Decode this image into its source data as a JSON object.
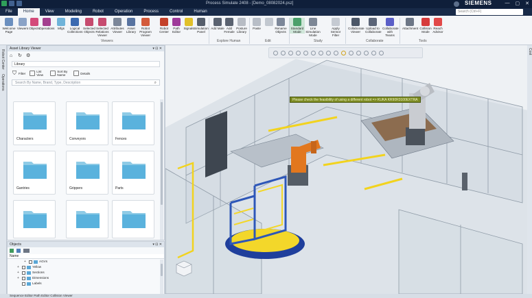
{
  "window": {
    "title": "Process Simulate 2408 - [Demo_08082024.psz]",
    "brand": "SIEMENS",
    "controls": [
      "—",
      "▢",
      "✕"
    ]
  },
  "menu": {
    "items": [
      "File",
      "Home",
      "View",
      "Modeling",
      "Robot",
      "Operation",
      "Process",
      "Control",
      "Human"
    ],
    "active": "Home",
    "search_placeholder": "Search (Ctrl+F)"
  },
  "ribbon": {
    "groups": [
      "Viewers",
      "Explore Human",
      "Edit",
      "Study",
      "Collaborate",
      "Tools"
    ],
    "buttons": {
      "welcome": "Welcome Page",
      "viewers": "Viewers",
      "objects": "Objects",
      "operations": "Operations",
      "mfgs": "Mfgs",
      "logical_collections": "Logical Collections",
      "selected_objects": "Selected Objects",
      "selected_relations": "Selected Relations Viewer",
      "attributes": "Attributes Viewer",
      "asset_library": "Asset Library",
      "robot_program": "Robot Program Viewer",
      "robot_center": "Robot Center",
      "path_editor": "Path Editor",
      "signals": "Signals",
      "simulation_panel": "Simulation Panel",
      "add_male": "Add Male",
      "add_female": "Add Female",
      "posture_library": "Posture Library",
      "paste": "Paste",
      "copy": "",
      "rename_objects": "Rename Objects",
      "standard_mode": "Standard Mode",
      "line_simulation": "Line Simulation Mode",
      "apply_filter": "Apply Sensor Filter",
      "collaborate_viewer": "Collaborate Viewer",
      "upload": "Upload to Collaborate",
      "collab_teams": "Collaborate with Teams",
      "attachment": "Attachment",
      "collision_mode": "Collision Mode",
      "reach_advisor": "Reach Advisor"
    }
  },
  "left_tabs": [
    "Robot Center",
    "Operations"
  ],
  "right_tabs": [
    "Cost"
  ],
  "asset_library": {
    "title": "Asset Library Viewer",
    "path_label": "Library",
    "filter_label": "Filter",
    "list_view_label": "List View",
    "sort_label": "Sort By Name",
    "details_label": "Details",
    "search_placeholder": "Search By Name, Brand, Type, Description",
    "folders": [
      "Characters",
      "Conveyors",
      "Fences",
      "Gantries",
      "Grippers",
      "Parts",
      "",
      "",
      ""
    ]
  },
  "objects_panel": {
    "title": "Objects",
    "column": "Name",
    "rows": [
      "AGVs",
      "Yellow",
      "Sections",
      "Dimensions",
      "Labels",
      "Frames"
    ]
  },
  "viewport": {
    "message": "Please check the feasibility of using a different robot => KUKA KR90R3100EXTRA"
  },
  "statusbar": {
    "text": "Sequence Editor  Path Editor  Collision Viewer"
  },
  "colors": {
    "titlebar": "#0f1f3a",
    "menubar": "#182a48",
    "robot_orange": "#e2771e",
    "fence_yellow": "#f2d31e",
    "accent_blue": "#2e57b8"
  }
}
